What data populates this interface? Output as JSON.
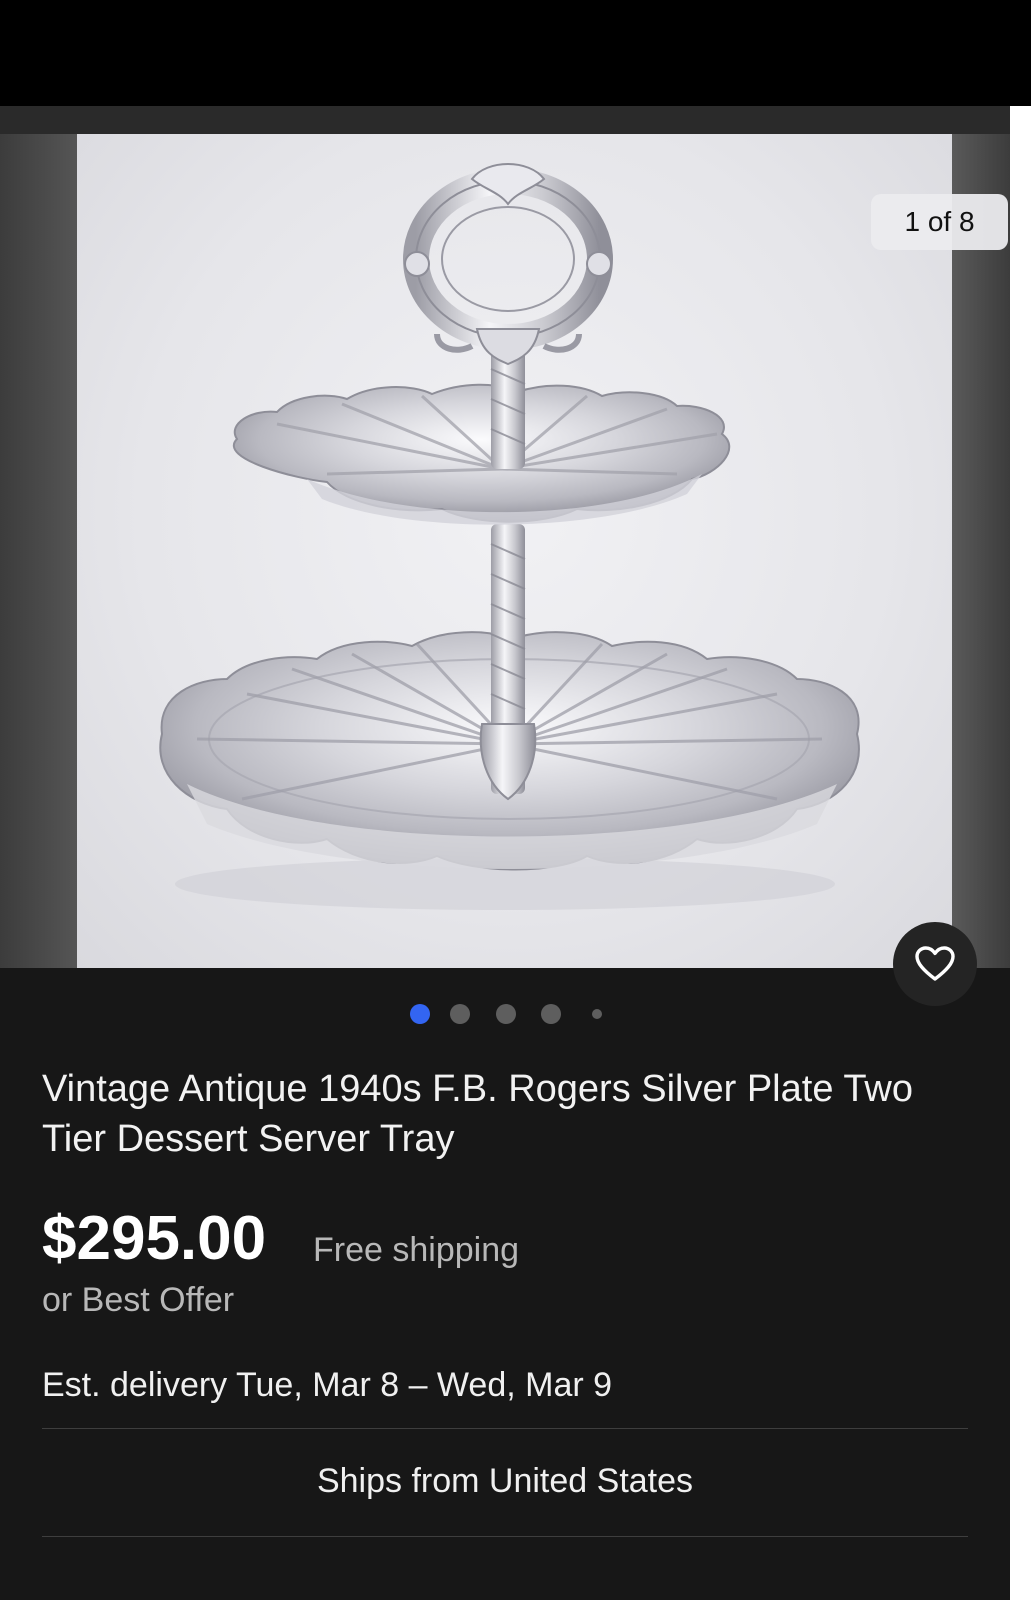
{
  "gallery": {
    "counter": "1 of 8",
    "dots_total": 5,
    "active_dot": 0
  },
  "listing": {
    "title": "Vintage Antique 1940s F.B. Rogers Silver Plate Two Tier Dessert Server Tray",
    "price": "$295.00",
    "shipping": "Free shipping",
    "offer": "or Best Offer",
    "delivery": "Est. delivery Tue, Mar 8 – Wed, Mar 9",
    "ships_from": "Ships from United States"
  },
  "icons": {
    "watch": "heart-icon"
  },
  "colors": {
    "background": "#171717",
    "active_dot": "#3365f2",
    "inactive_dot": "#5e5e5e",
    "price": "#ffffff",
    "secondary_text": "#b8b8b8"
  }
}
